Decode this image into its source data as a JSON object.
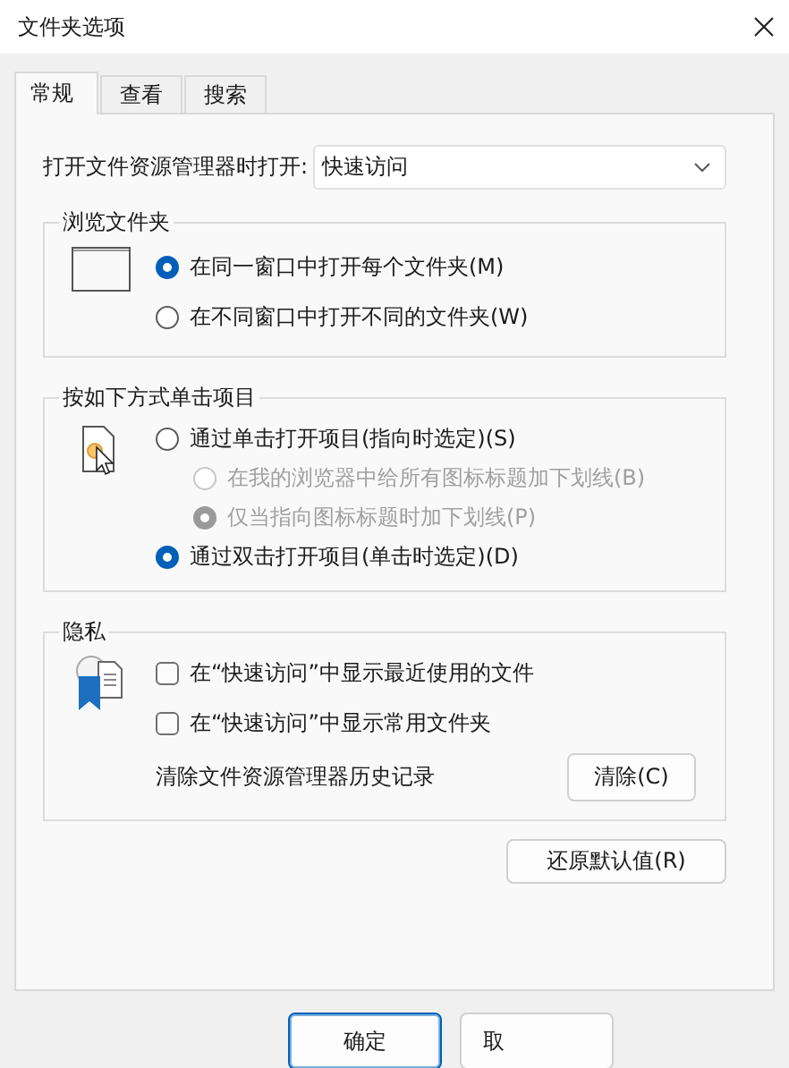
{
  "window": {
    "title": "文件夹选项"
  },
  "tabs": [
    {
      "label": "常规",
      "selected": true
    },
    {
      "label": "查看",
      "selected": false
    },
    {
      "label": "搜索",
      "selected": false
    }
  ],
  "open_in": {
    "label": "打开文件资源管理器时打开:",
    "value": "快速访问"
  },
  "browse_folders": {
    "title": "浏览文件夹",
    "options": [
      {
        "label": "在同一窗口中打开每个文件夹(M)",
        "selected": true,
        "disabled": false
      },
      {
        "label": "在不同窗口中打开不同的文件夹(W)",
        "selected": false,
        "disabled": false
      }
    ]
  },
  "click_items": {
    "title": "按如下方式单击项目",
    "options": [
      {
        "label": "通过单击打开项目(指向时选定)(S)",
        "selected": false,
        "disabled": false,
        "children": [
          {
            "label": "在我的浏览器中给所有图标标题加下划线(B)",
            "selected": false,
            "disabled": true
          },
          {
            "label": "仅当指向图标标题时加下划线(P)",
            "selected": true,
            "disabled": true
          }
        ]
      },
      {
        "label": "通过双击打开项目(单击时选定)(D)",
        "selected": true,
        "disabled": false
      }
    ]
  },
  "privacy": {
    "title": "隐私",
    "checkboxes": [
      {
        "label": "在“快速访问”中显示最近使用的文件",
        "checked": false
      },
      {
        "label": "在“快速访问”中显示常用文件夹",
        "checked": false
      }
    ],
    "clear_label": "清除文件资源管理器历史记录",
    "clear_button": "清除(C)"
  },
  "restore_button": "还原默认值(R)",
  "footer_buttons": [
    {
      "label": "确定",
      "kind": "default"
    },
    {
      "label": "取",
      "kind": "normal"
    }
  ]
}
